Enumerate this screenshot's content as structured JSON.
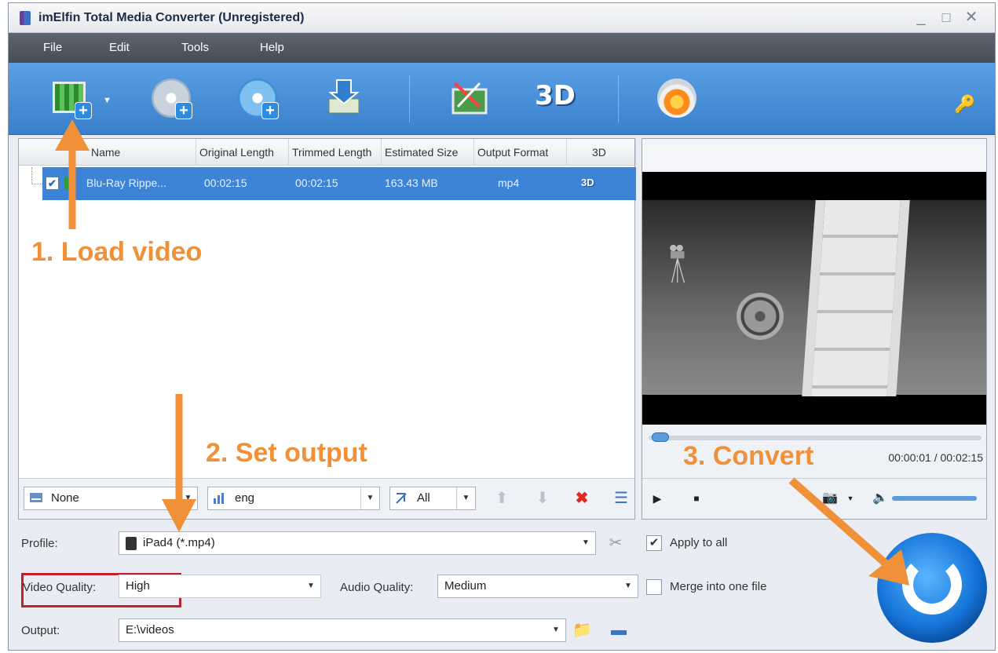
{
  "window": {
    "title": "imElfin Total Media Converter (Unregistered)",
    "controls": [
      "_",
      "□",
      "✕"
    ]
  },
  "menu": [
    "File",
    "Edit",
    "Tools",
    "Help"
  ],
  "file_list": {
    "columns": [
      "Name",
      "Original Length",
      "Trimmed Length",
      "Estimated Size",
      "Output Format",
      "3D"
    ],
    "rows": [
      {
        "name": "Blu-Ray Rippe...",
        "original_length": "00:02:15",
        "trimmed_length": "00:02:15",
        "estimated_size": "163.43 MB",
        "output_format": "mp4",
        "three_d": "3D"
      }
    ]
  },
  "list_bottom": {
    "subtitle_value": "None",
    "audio_track_value": "eng",
    "filter_value": "All"
  },
  "preview": {
    "time": "00:00:01 / 00:02:15",
    "playback_position_fraction": 0.01,
    "volume_fraction": 1.0
  },
  "settings": {
    "profile_label": "Profile:",
    "profile_value": "iPad4 (*.mp4)",
    "apply_to_all_label": "Apply to all",
    "apply_to_all_checked": true,
    "video_quality_label": "Video Quality:",
    "video_quality_value": "High",
    "audio_quality_label": "Audio Quality:",
    "audio_quality_value": "Medium",
    "merge_label": "Merge into one file",
    "merge_checked": false,
    "output_label": "Output:",
    "output_value": "E:\\videos"
  },
  "annotations": {
    "step1": "1. Load video",
    "step2": "2. Set output",
    "step3": "3. Convert"
  },
  "colors": {
    "toolbar": "#3f86d0",
    "selected_row": "#3d84d6",
    "annotation": "#f0913a",
    "highlight_box": "#c0202a"
  }
}
